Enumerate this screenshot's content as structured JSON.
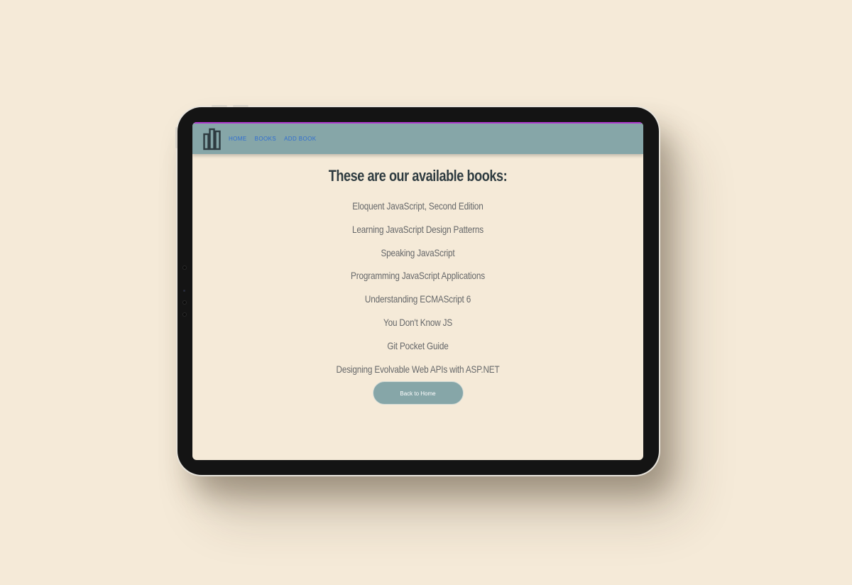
{
  "nav": {
    "logo_icon": "books-logo-icon",
    "links": [
      {
        "label": "HOME"
      },
      {
        "label": "BOOKS"
      },
      {
        "label": "ADD BOOK"
      }
    ]
  },
  "main": {
    "title": "These are our available books:",
    "books": [
      "Eloquent JavaScript, Second Edition",
      "Learning JavaScript Design Patterns",
      "Speaking JavaScript",
      "Programming JavaScript Applications",
      "Understanding ECMAScript 6",
      "You Don't Know JS",
      "Git Pocket Guide",
      "Designing Evolvable Web APIs with ASP.NET"
    ],
    "back_button_label": "Back to Home"
  },
  "colors": {
    "page_background": "#f5ead8",
    "navbar": "#86a6a8",
    "nav_link": "#2f6dd1",
    "title_text": "#2e3b40",
    "book_text": "#66686a",
    "device_bezel": "#141414"
  }
}
